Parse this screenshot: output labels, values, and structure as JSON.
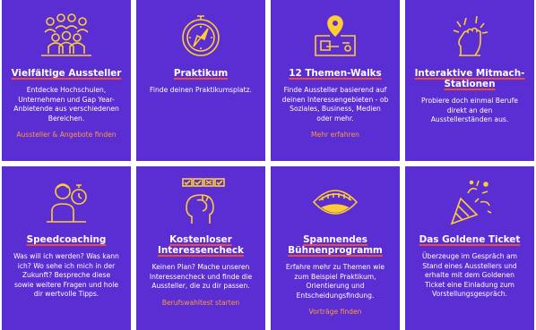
{
  "colors": {
    "tile_bg": "#5a2ed2",
    "icon": "#ffcc33",
    "underline": "#f04a3c",
    "link": "#ff9a36"
  },
  "tiles": [
    {
      "icon": "crowd-icon",
      "title": "Vielfältige Aussteller",
      "desc": "Entdecke Hochschulen, Unternehmen und Gap Year-Anbietende aus verschiedenen Bereichen.",
      "link": "Aussteller & Angebote finden"
    },
    {
      "icon": "compass-icon",
      "title": "Praktikum",
      "desc": "Finde deinen Praktikumsplatz.",
      "link": ""
    },
    {
      "icon": "map-pin-icon",
      "title": "12 Themen-Walks",
      "desc": "Finde Aussteller basierend auf deinen Interessengebieten - ob Soziales, Business, Medien oder mehr.",
      "link": "Mehr erfahren"
    },
    {
      "icon": "hand-icon",
      "title": "Interaktive Mitmach-Stationen",
      "desc": "Probiere doch einmal Berufe direkt an den Ausstellerständen aus.",
      "link": ""
    },
    {
      "icon": "coach-stopwatch-icon",
      "title": "Speedcoaching",
      "desc": "Was will ich werden? Was kann ich? Wo sehe ich mich in der Zukunft? Bespreche diese sowie weitere Fragen und hole dir wertvolle Tipps.",
      "link": ""
    },
    {
      "icon": "head-check-icon",
      "title": "Kostenloser Interessencheck",
      "desc": "Keinen Plan? Mache unseren Interessencheck und finde die Aussteller, die zu dir passen.",
      "link": "Berufswahltest starten"
    },
    {
      "icon": "mouth-icon",
      "title": "Spannendes Bühnenprogramm",
      "desc": "Erfahre mehr zu Themen wie zum Beispiel Praktikum, Orientierung und Entscheidungsfindung.",
      "link": "Vorträge finden"
    },
    {
      "icon": "party-popper-icon",
      "title": "Das Goldene Ticket",
      "desc": "Überzeuge im Gespräch am Stand eines Ausstellers und erhalte mit dem Goldenen Ticket eine Einladung zum Vorstellungsgespräch.",
      "link": ""
    }
  ]
}
